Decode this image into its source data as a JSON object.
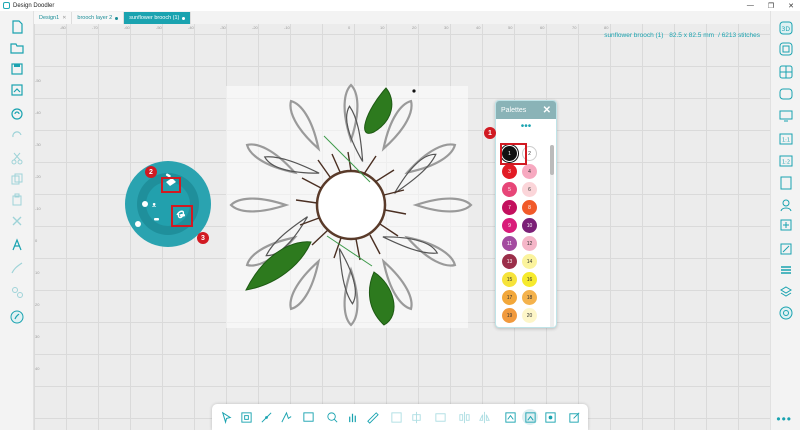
{
  "app": {
    "title": "Design Doodler"
  },
  "tabs": [
    {
      "label": "Design1",
      "active": false,
      "closable": true
    },
    {
      "label": "brooch layer 2",
      "active": false,
      "modified": true
    },
    {
      "label": "sunflower brooch (1)",
      "active": true,
      "modified": true
    }
  ],
  "design_info": {
    "name": "sunflower brooch (1)",
    "size": "82.5 x 82.5 mm",
    "stitches": "6213 stitches"
  },
  "ruler": {
    "top": [
      "-80",
      "-70",
      "-60",
      "-50",
      "-40",
      "-30",
      "-20",
      "-10",
      "0",
      "10",
      "20",
      "30",
      "40",
      "50",
      "60",
      "70",
      "80"
    ],
    "left": [
      "-50",
      "-40",
      "-30",
      "-20",
      "-10",
      "0",
      "10",
      "20",
      "30",
      "40"
    ]
  },
  "palette": {
    "title": "Palettes",
    "close": "✕",
    "more": "•••",
    "swatches": [
      {
        "n": "1",
        "color": "#111111",
        "selected": true
      },
      {
        "n": "2",
        "color": "#ffffff"
      },
      {
        "n": "3",
        "color": "#e21b25"
      },
      {
        "n": "4",
        "color": "#f7a9c0"
      },
      {
        "n": "5",
        "color": "#e74678"
      },
      {
        "n": "6",
        "color": "#fbd5d9"
      },
      {
        "n": "7",
        "color": "#c3105e"
      },
      {
        "n": "8",
        "color": "#f15a29"
      },
      {
        "n": "9",
        "color": "#d91c7a"
      },
      {
        "n": "10",
        "color": "#7b2077"
      },
      {
        "n": "11",
        "color": "#a34ba0"
      },
      {
        "n": "12",
        "color": "#f5b6c8"
      },
      {
        "n": "13",
        "color": "#9b2f4a"
      },
      {
        "n": "14",
        "color": "#fbf39d"
      },
      {
        "n": "15",
        "color": "#f6e33a"
      },
      {
        "n": "16",
        "color": "#f6ea2d"
      },
      {
        "n": "17",
        "color": "#f2a73a"
      },
      {
        "n": "18",
        "color": "#f4b24c"
      },
      {
        "n": "19",
        "color": "#f19a3e"
      },
      {
        "n": "20",
        "color": "#fdf6c9"
      }
    ]
  },
  "callouts": [
    "1",
    "2",
    "3"
  ],
  "colors": {
    "accent": "#1aa3b0",
    "callout": "#d11a22",
    "leaf": "#2d7a1e"
  },
  "left_tools": [
    "new-file-icon",
    "open-folder-icon",
    "save-icon",
    "import-icon",
    "auto-digitize-icon",
    "redo-icon",
    "cut-icon",
    "copy-icon",
    "paste-icon",
    "delete-icon",
    "text-icon",
    "draw-icon",
    "stitch-settings-icon",
    "doodle-icon"
  ],
  "right_tools": [
    "view-3d-icon",
    "view-2d-icon",
    "grid-icon",
    "hoop-icon",
    "screen-icon",
    "fit-1-1-icon",
    "fit-page-icon",
    "hoop-size-icon",
    "add-design-icon",
    "edit-image-icon",
    "layers-icon",
    "sequence-icon",
    "stitch-view-icon"
  ],
  "bottom_tools": [
    "select-tool",
    "box-select-tool",
    "node-edit-tool",
    "draw-tool",
    "shape-tool",
    "zoom-tool",
    "pan-tool",
    "measure-tool",
    "align-tool",
    "distribute-tool",
    "group-tool",
    "flip-tool",
    "mirror-tool",
    "stitch-preview",
    "hoop-view",
    "realistic-view",
    "edit-tool"
  ]
}
